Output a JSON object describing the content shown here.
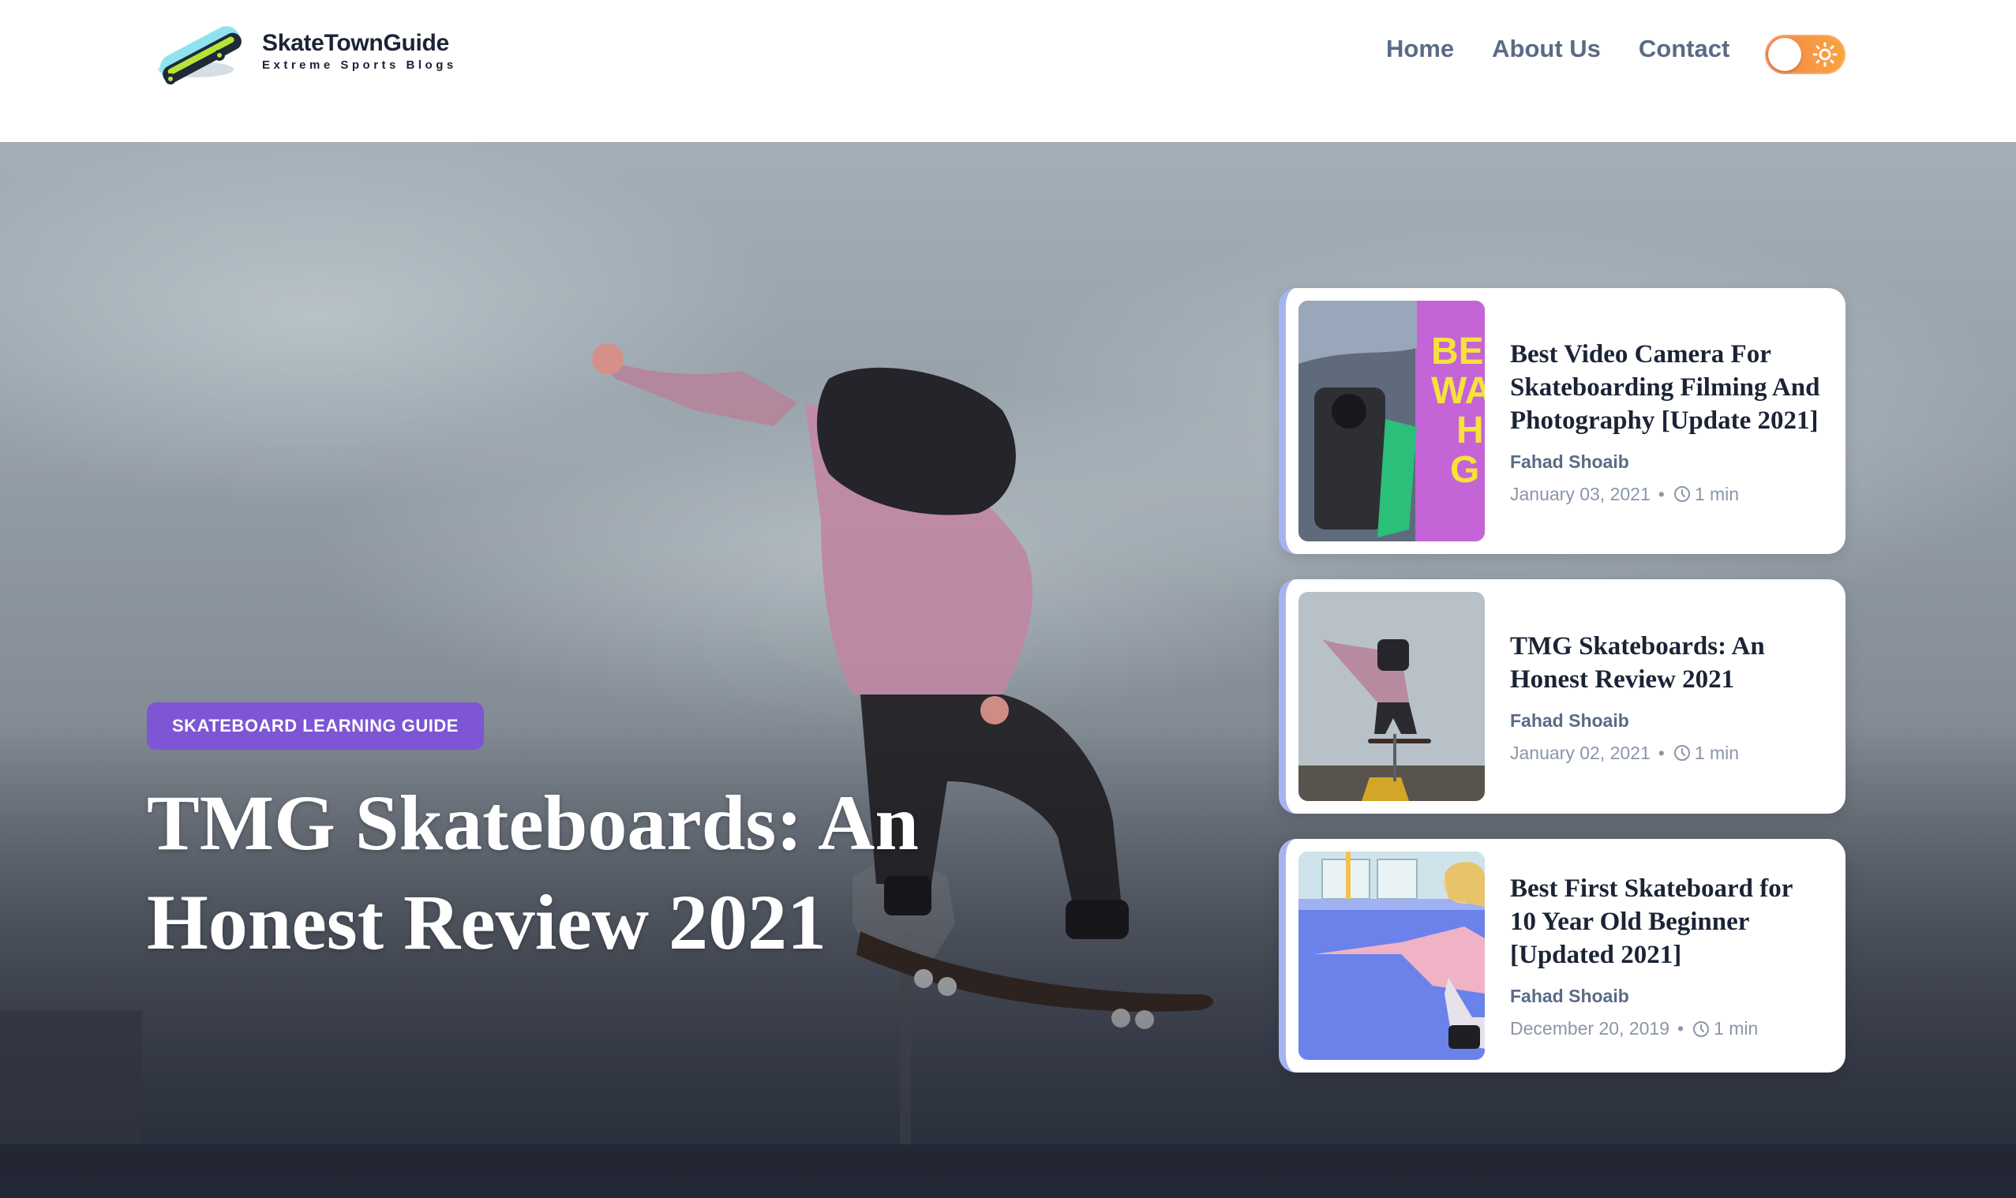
{
  "brand": {
    "name": "SkateTownGuide",
    "tagline": "Extreme Sports Blogs"
  },
  "nav": {
    "items": [
      "Home",
      "About Us",
      "Contact"
    ]
  },
  "theme_toggle": {
    "state": "light",
    "icon": "sun-icon",
    "color": "#f9844a"
  },
  "hero": {
    "category": "SKATEBOARD LEARNING GUIDE",
    "title": "TMG Skateboards: An Honest Review 2021"
  },
  "posts": [
    {
      "title": "Best Video Camera For Skateboarding Filming And Photography [Update 2021]",
      "author": "Fahad Shoaib",
      "date": "January 03, 2021",
      "read_time": "1 min"
    },
    {
      "title": "TMG Skateboards: An Honest Review 2021",
      "author": "Fahad Shoaib",
      "date": "January 02, 2021",
      "read_time": "1 min"
    },
    {
      "title": "Best First Skateboard for 10 Year Old Beginner [Updated 2021]",
      "author": "Fahad Shoaib",
      "date": "December 20, 2019",
      "read_time": "1 min"
    }
  ],
  "colors": {
    "accent": "#7e55d4",
    "card_border": "#a5b3f2",
    "text_dark": "#1b2436",
    "text_muted": "#5b6b86"
  }
}
